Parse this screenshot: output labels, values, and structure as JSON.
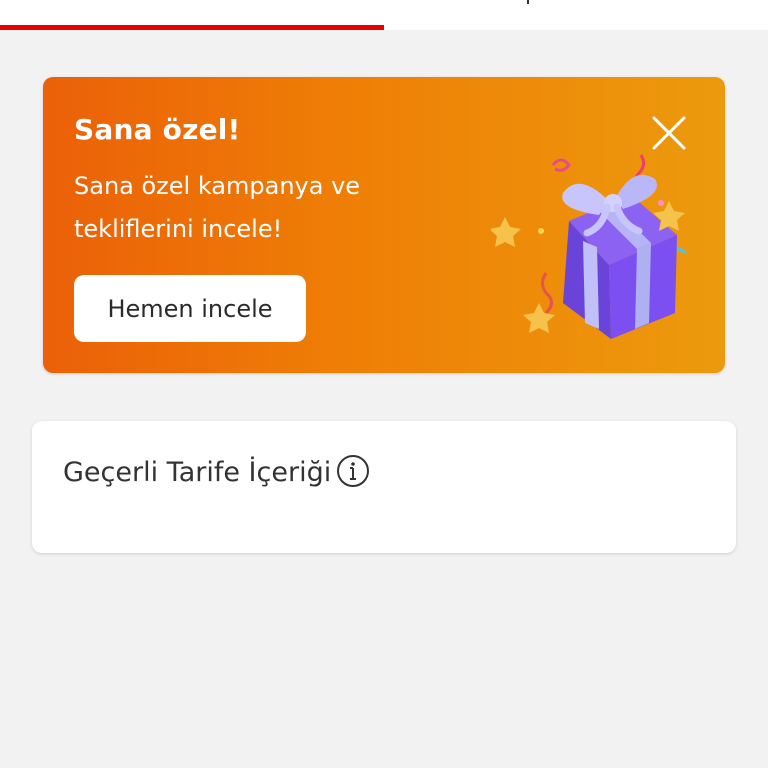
{
  "promo": {
    "title": "Sana özel!",
    "body": "Sana özel kampanya ve tekliflerini incele!",
    "button_label": "Hemen incele",
    "icons": [
      "close-icon",
      "gift-icon"
    ],
    "colors": {
      "gradient_start": "#eb6008",
      "gradient_end": "#ec9a0d"
    }
  },
  "tariff": {
    "title": "Geçerli Tarife İçeriği",
    "icon": "info-icon"
  },
  "tabs": {
    "active_color": "#e60000"
  }
}
